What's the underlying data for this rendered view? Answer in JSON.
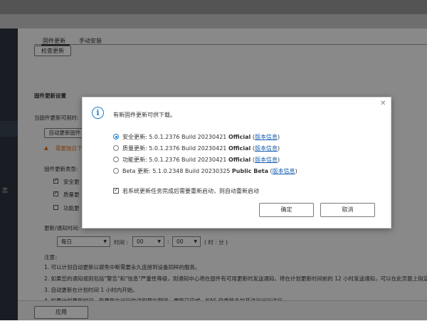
{
  "nav": {
    "partial_label": "志"
  },
  "tabs": [
    {
      "label": "固件更新"
    },
    {
      "label": "手动安装"
    }
  ],
  "check_update_label": "检查更新",
  "settings": {
    "title": "固件更新设置",
    "available_label": "当固件更新可用时:",
    "auto_update_label": "自动更新固件",
    "warning_text": "需要独自下",
    "types_label": "固件更新类型:",
    "types": [
      {
        "label": "安全更",
        "checked": true
      },
      {
        "label": "质量更",
        "checked": true
      },
      {
        "label": "功能更",
        "checked": false
      }
    ],
    "schedule_label": "更新/通知时间:",
    "frequency": "每日",
    "time_label": "时间 :",
    "hour": "00",
    "minute": "00",
    "time_unit": "( 时 : 分 )",
    "notes_title": "注意：",
    "notes": [
      "1. 可以计划自动更新以避免中断需要永久连接到设备同样的服务。",
      "2. 如果您的通知规则包括\"警告\"和\"信息\"严重性等级，则通知中心将在固件有可用更新时发送通知，将在计划更新时间前的 12 小时发送通知，可以在此页面上指定或更",
      "3. 自动更新在计划时间 1 小时内开始。",
      "4. 如果计划更新时间，新更新在运行的进程都在期待，更新已完成，NAS 仍重新多的其进行运行进行"
    ],
    "apply_label": "应用"
  },
  "dialog": {
    "title": "有新固件更新可供下载。",
    "close_icon": "close-icon",
    "info_icon": "info-icon",
    "options": [
      {
        "prefix": "安全更新: 5.0.1.2376 Build 20230421 ",
        "edition": "Official",
        "link": "版本信息",
        "selected": true
      },
      {
        "prefix": "质量更新: 5.0.1.2376 Build 20230421 ",
        "edition": "Official",
        "link": "版本信息",
        "selected": false
      },
      {
        "prefix": "功能更新: 5.0.1.2376 Build 20230421 ",
        "edition": "Official",
        "link": "版本信息",
        "selected": false
      },
      {
        "prefix": "Beta 更新: 5.1.0.2348 Build 20230325 ",
        "edition": "Public Beta",
        "link": "版本信息",
        "selected": false
      }
    ],
    "checkbox_label": "若系统更新任务完成后需要重新启动，则自动重新启动",
    "checkbox_checked": true,
    "ok_label": "确定",
    "cancel_label": "取消"
  }
}
